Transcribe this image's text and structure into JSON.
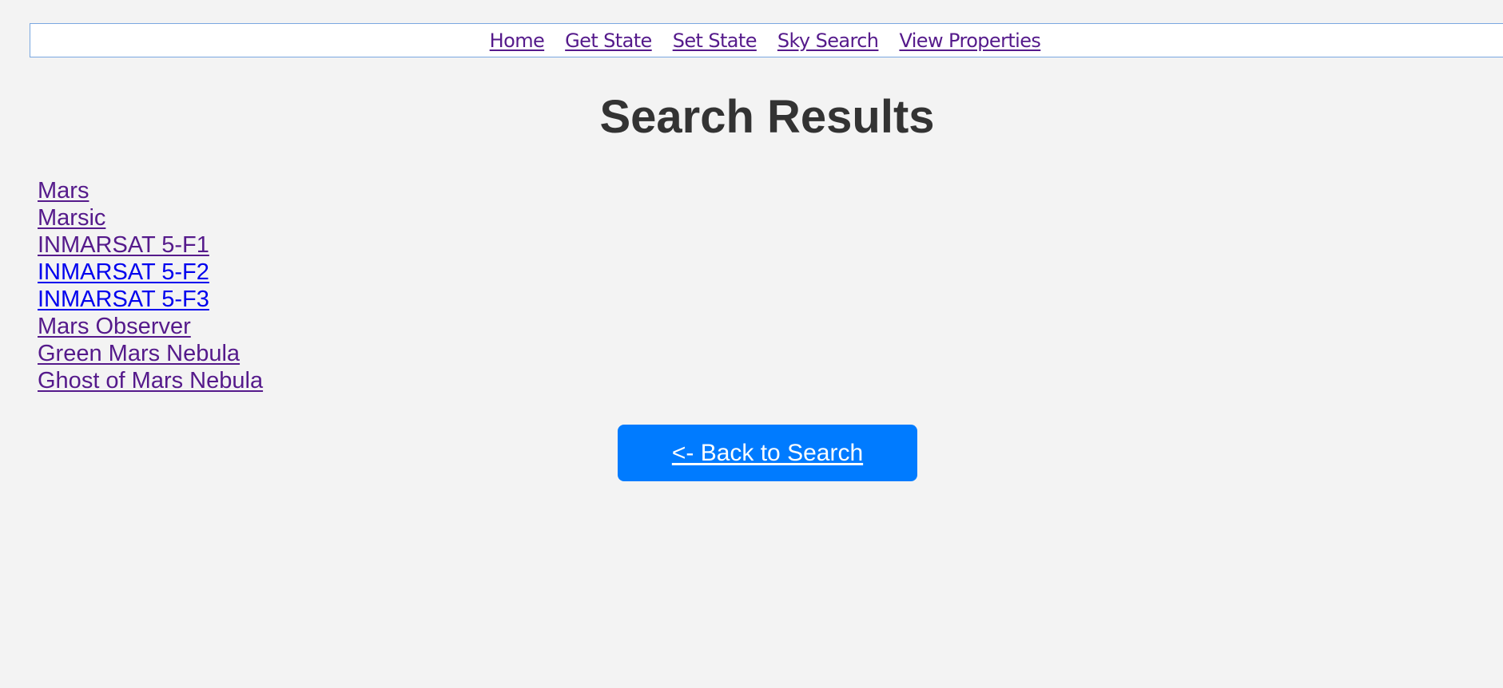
{
  "nav": {
    "links": [
      {
        "label": "Home"
      },
      {
        "label": "Get State"
      },
      {
        "label": "Set State"
      },
      {
        "label": "Sky Search"
      },
      {
        "label": "View Properties"
      }
    ],
    "link_color": "#551a8b",
    "border_color": "#7aa7e0"
  },
  "main": {
    "title": "Search Results",
    "results": [
      {
        "label": "Mars",
        "visited": true
      },
      {
        "label": "Marsic",
        "visited": true
      },
      {
        "label": "INMARSAT 5-F1",
        "visited": true
      },
      {
        "label": "INMARSAT 5-F2",
        "visited": false
      },
      {
        "label": "INMARSAT 5-F3",
        "visited": false
      },
      {
        "label": "Mars Observer",
        "visited": true
      },
      {
        "label": "Green Mars Nebula",
        "visited": true
      },
      {
        "label": "Ghost of Mars Nebula",
        "visited": true
      }
    ],
    "back_button": {
      "label": "<- Back to Search"
    }
  },
  "colors": {
    "background": "#f3f3f3",
    "visited_link": "#551a8b",
    "unvisited_link": "#0000ee",
    "button": "#007bff",
    "title": "#333333"
  }
}
